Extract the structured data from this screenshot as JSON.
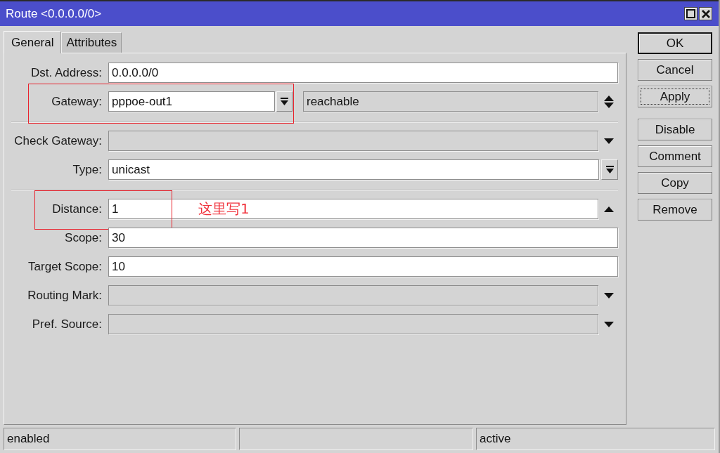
{
  "window": {
    "title": "Route <0.0.0.0/0>"
  },
  "tabs": [
    {
      "label": "General",
      "selected": true
    },
    {
      "label": "Attributes",
      "selected": false
    }
  ],
  "sections": [
    [
      {
        "kind": "plain",
        "label": "Dst. Address:",
        "value": "0.0.0.0/0",
        "highlighted": false
      },
      {
        "kind": "gateway",
        "label": "Gateway:",
        "value": "pppoe-out1",
        "status": "reachable",
        "highlighted": true
      }
    ],
    [
      {
        "kind": "unset",
        "label": "Check Gateway:",
        "highlighted": false
      },
      {
        "kind": "select",
        "label": "Type:",
        "value": "unicast",
        "highlighted": false
      }
    ],
    [
      {
        "kind": "set",
        "label": "Distance:",
        "value": "1",
        "highlighted": true,
        "note": "这里写1"
      },
      {
        "kind": "plain",
        "label": "Scope:",
        "value": "30",
        "highlighted": false
      },
      {
        "kind": "plain",
        "label": "Target Scope:",
        "value": "10",
        "highlighted": false
      },
      {
        "kind": "unset",
        "label": "Routing Mark:",
        "highlighted": false
      },
      {
        "kind": "unset",
        "label": "Pref. Source:",
        "highlighted": false
      }
    ]
  ],
  "button_groups": [
    [
      {
        "label": "OK",
        "default": true,
        "focused": false
      },
      {
        "label": "Cancel",
        "default": false,
        "focused": false
      },
      {
        "label": "Apply",
        "default": false,
        "focused": true
      }
    ],
    [
      {
        "label": "Disable",
        "default": false,
        "focused": false
      },
      {
        "label": "Comment",
        "default": false,
        "focused": false
      },
      {
        "label": "Copy",
        "default": false,
        "focused": false
      },
      {
        "label": "Remove",
        "default": false,
        "focused": false
      }
    ]
  ],
  "status_bar": {
    "left": "enabled",
    "right": "active"
  }
}
